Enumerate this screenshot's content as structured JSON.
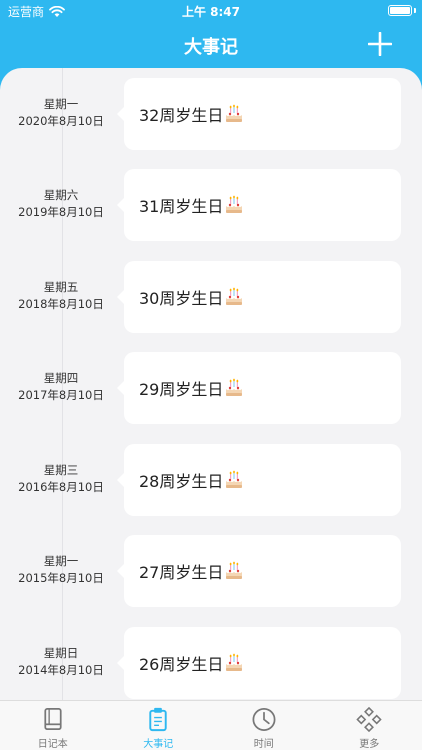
{
  "status_bar": {
    "carrier": "运营商",
    "time": "上午 8:47"
  },
  "header": {
    "title": "大事记",
    "add_icon": "plus-icon"
  },
  "events": [
    {
      "weekday": "星期一",
      "date": "2020年8月10日",
      "title": "32周岁生日",
      "icon": "birthday-cake"
    },
    {
      "weekday": "星期六",
      "date": "2019年8月10日",
      "title": "31周岁生日",
      "icon": "birthday-cake"
    },
    {
      "weekday": "星期五",
      "date": "2018年8月10日",
      "title": "30周岁生日",
      "icon": "birthday-cake"
    },
    {
      "weekday": "星期四",
      "date": "2017年8月10日",
      "title": "29周岁生日",
      "icon": "birthday-cake"
    },
    {
      "weekday": "星期三",
      "date": "2016年8月10日",
      "title": "28周岁生日",
      "icon": "birthday-cake"
    },
    {
      "weekday": "星期一",
      "date": "2015年8月10日",
      "title": "27周岁生日",
      "icon": "birthday-cake"
    },
    {
      "weekday": "星期日",
      "date": "2014年8月10日",
      "title": "26周岁生日",
      "icon": "birthday-cake"
    }
  ],
  "tab_bar": {
    "tabs": [
      {
        "label": "日记本",
        "icon": "notebook-icon",
        "active": false
      },
      {
        "label": "大事记",
        "icon": "clipboard-icon",
        "active": true
      },
      {
        "label": "时间",
        "icon": "clock-icon",
        "active": false
      },
      {
        "label": "更多",
        "icon": "diamond-grid-icon",
        "active": false
      }
    ]
  },
  "colors": {
    "accent": "#2EB8F0",
    "background": "#F3F3F5",
    "card": "#FFFFFF",
    "inactive": "#777777"
  }
}
